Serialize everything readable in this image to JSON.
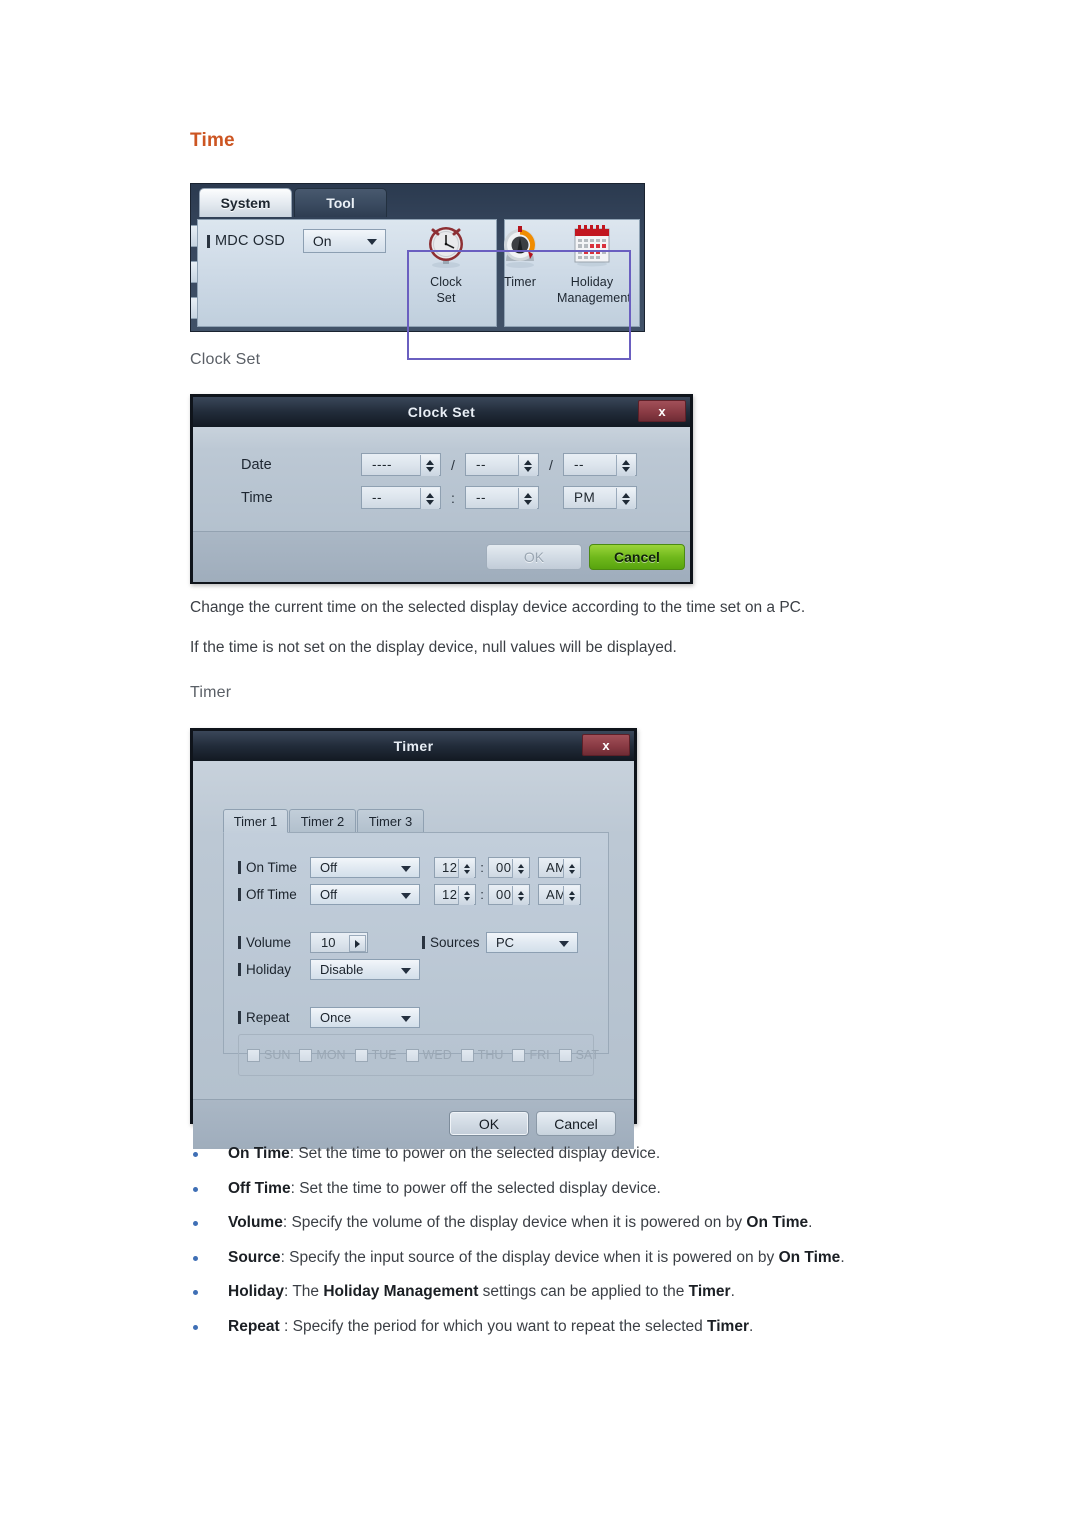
{
  "section": {
    "heading": "Time",
    "sub_clock_set": "Clock Set",
    "sub_timer": "Timer"
  },
  "paragraphs": {
    "p1": "Change the current time on the selected display device according to the time set on a PC.",
    "p2": "If the time is not set on the display device, null values will be displayed."
  },
  "mdc_panel": {
    "tabs": [
      {
        "label": "System",
        "active": true
      },
      {
        "label": "Tool",
        "active": false
      }
    ],
    "osd_label": "MDC OSD",
    "osd_value": "On",
    "tools": [
      {
        "line1": "Clock",
        "line2": "Set",
        "icon": "clock-icon"
      },
      {
        "line1": "Timer",
        "line2": "",
        "icon": "timer-dial-icon"
      },
      {
        "line1": "Holiday",
        "line2": "Management",
        "icon": "calendar-icon"
      }
    ],
    "selection_color": "#6a5fc0"
  },
  "clock_set_dialog": {
    "title": "Clock Set",
    "close_label": "x",
    "date_label": "Date",
    "time_label": "Time",
    "date_year": "----",
    "date_month": "--",
    "date_day": "--",
    "date_sep1": "/",
    "date_sep2": "/",
    "time_hour": "--",
    "time_minute": "--",
    "time_ampm": "PM",
    "time_sep": ":",
    "ok_label": "OK",
    "cancel_label": "Cancel",
    "ok_disabled": true,
    "cancel_color": "#6fb81b"
  },
  "timer_dialog": {
    "title": "Timer",
    "close_label": "x",
    "tabs": [
      "Timer 1",
      "Timer 2",
      "Timer 3"
    ],
    "active_tab": "Timer 1",
    "rows": {
      "on_time_label": "On Time",
      "on_time_mode": "Off",
      "on_time_hour": "12",
      "on_time_minute": "00",
      "on_time_ampm": "AM",
      "off_time_label": "Off Time",
      "off_time_mode": "Off",
      "off_time_hour": "12",
      "off_time_minute": "00",
      "off_time_ampm": "AM",
      "volume_label": "Volume",
      "volume_value": "10",
      "sources_label": "Sources",
      "sources_value": "PC",
      "holiday_label": "Holiday",
      "holiday_value": "Disable",
      "repeat_label": "Repeat",
      "repeat_value": "Once"
    },
    "time_colon": ":",
    "days": [
      {
        "label": "SUN",
        "checked": false
      },
      {
        "label": "MON",
        "checked": false
      },
      {
        "label": "TUE",
        "checked": false
      },
      {
        "label": "WED",
        "checked": false
      },
      {
        "label": "THU",
        "checked": false
      },
      {
        "label": "FRI",
        "checked": false
      },
      {
        "label": "SAT",
        "checked": false
      }
    ],
    "ok_label": "OK",
    "cancel_label": "Cancel"
  },
  "bullets": [
    {
      "term": "On Time",
      "rest": ": Set the time to power on the selected display device."
    },
    {
      "term": "Off Time",
      "rest": ": Set the time to power off the selected display device."
    },
    {
      "term": "Volume",
      "rest": ": Specify the volume of the display device when it is powered on by ",
      "term2": "On Time",
      "tail": "."
    },
    {
      "term": "Source",
      "rest": ": Specify the input source of the display device when it is powered on by ",
      "term2": "On Time",
      "tail": "."
    },
    {
      "term": "Holiday",
      "rest": ": The ",
      "term2": "Holiday Management",
      "rest2": " settings can be applied to the ",
      "term3": "Timer",
      "tail": "."
    },
    {
      "term": "Repeat",
      "rest": " : Specify the period for which you want to repeat the selected ",
      "term2": "Timer",
      "tail": "."
    }
  ]
}
